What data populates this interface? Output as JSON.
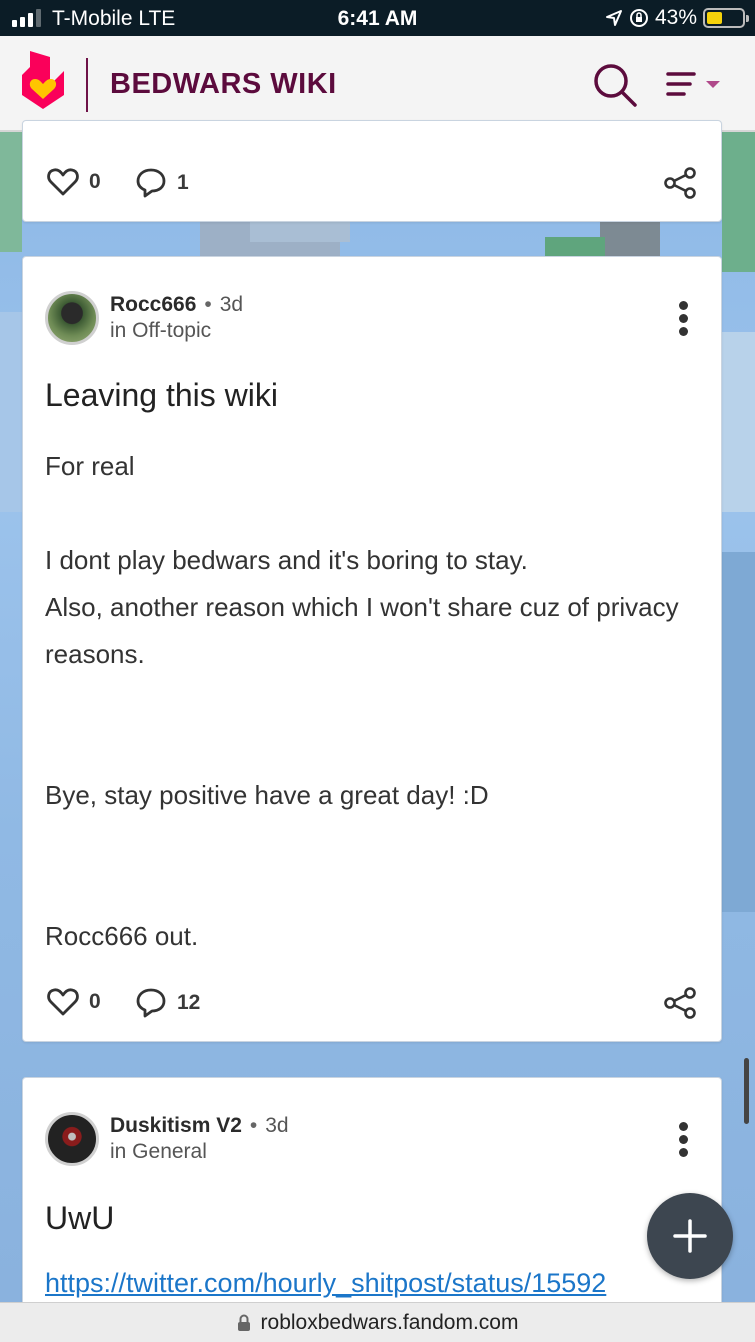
{
  "status_bar": {
    "carrier": "T-Mobile  LTE",
    "time": "6:41 AM",
    "battery": "43%",
    "battery_level": 0.43
  },
  "header": {
    "title": "BEDWARS WIKI",
    "brand_color": "#5c0b3d",
    "logo_color": "#fa005a"
  },
  "posts": [
    {
      "likes": "0",
      "comments": "1"
    },
    {
      "author": "Rocc666",
      "separator": "•",
      "age": "3d",
      "category": "in Off-topic",
      "title": "Leaving this wiki",
      "body": [
        "For real",
        "",
        "I dont play bedwars and it's boring to stay.",
        "Also, another reason which I won't share cuz of privacy reasons.",
        "",
        "",
        "Bye, stay positive have a great day! :D",
        "",
        "",
        "Rocc666 out."
      ],
      "likes": "0",
      "comments": "12"
    },
    {
      "author": "Duskitism V2",
      "separator": "•",
      "age": "3d",
      "category": "in General",
      "title": "UwU",
      "link": "https://twitter.com/hourly_shitpost/status/15592"
    }
  ],
  "url_bar": {
    "domain": "robloxbedwars.fandom.com"
  }
}
